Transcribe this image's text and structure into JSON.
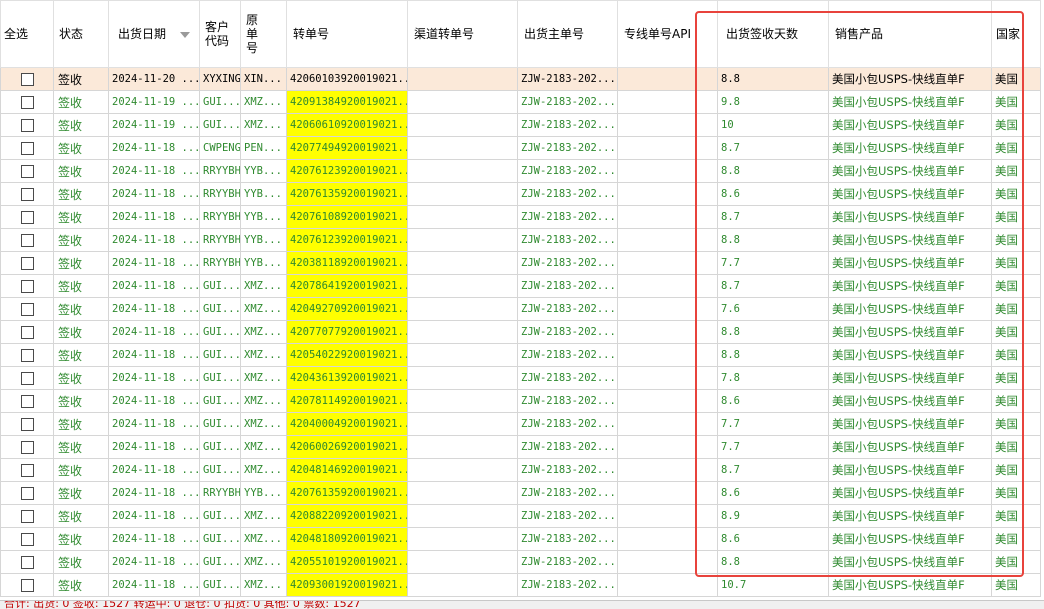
{
  "table": {
    "headers": {
      "select_all": "全选",
      "status": "状态",
      "ship_date": "出货日期",
      "customer_code": "客户代码",
      "original_no": "原单号",
      "transfer_no": "转单号",
      "channel_transfer_no": "渠道转单号",
      "master_no": "出货主单号",
      "line_api": "专线单号API",
      "sign_days": "出货签收天数",
      "product": "销售产品",
      "country": "国家"
    },
    "rows": [
      {
        "status": "签收",
        "date": "2024-11-20 ...",
        "customer": "XYXING",
        "orig": "XIN...",
        "transfer": "42060103920019021...",
        "master": "ZJW-2183-202...",
        "days": "8.8",
        "product": "美国小包USPS-快线直单F",
        "country": "美国"
      },
      {
        "status": "签收",
        "date": "2024-11-19 ...",
        "customer": "GUI...",
        "orig": "XMZ...",
        "transfer": "42091384920019021...",
        "master": "ZJW-2183-202...",
        "days": "9.8",
        "product": "美国小包USPS-快线直单F",
        "country": "美国"
      },
      {
        "status": "签收",
        "date": "2024-11-19 ...",
        "customer": "GUI...",
        "orig": "XMZ...",
        "transfer": "42060610920019021...",
        "master": "ZJW-2183-202...",
        "days": "10",
        "product": "美国小包USPS-快线直单F",
        "country": "美国"
      },
      {
        "status": "签收",
        "date": "2024-11-18 ...",
        "customer": "CWPENG",
        "orig": "PEN...",
        "transfer": "42077494920019021...",
        "master": "ZJW-2183-202...",
        "days": "8.7",
        "product": "美国小包USPS-快线直单F",
        "country": "美国"
      },
      {
        "status": "签收",
        "date": "2024-11-18 ...",
        "customer": "RRYYBH",
        "orig": "YYB...",
        "transfer": "42076123920019021...",
        "master": "ZJW-2183-202...",
        "days": "8.8",
        "product": "美国小包USPS-快线直单F",
        "country": "美国"
      },
      {
        "status": "签收",
        "date": "2024-11-18 ...",
        "customer": "RRYYBH",
        "orig": "YYB...",
        "transfer": "42076135920019021...",
        "master": "ZJW-2183-202...",
        "days": "8.6",
        "product": "美国小包USPS-快线直单F",
        "country": "美国"
      },
      {
        "status": "签收",
        "date": "2024-11-18 ...",
        "customer": "RRYYBH",
        "orig": "YYB...",
        "transfer": "42076108920019021...",
        "master": "ZJW-2183-202...",
        "days": "8.7",
        "product": "美国小包USPS-快线直单F",
        "country": "美国"
      },
      {
        "status": "签收",
        "date": "2024-11-18 ...",
        "customer": "RRYYBH",
        "orig": "YYB...",
        "transfer": "42076123920019021...",
        "master": "ZJW-2183-202...",
        "days": "8.8",
        "product": "美国小包USPS-快线直单F",
        "country": "美国"
      },
      {
        "status": "签收",
        "date": "2024-11-18 ...",
        "customer": "RRYYBH",
        "orig": "YYB...",
        "transfer": "42038118920019021...",
        "master": "ZJW-2183-202...",
        "days": "7.7",
        "product": "美国小包USPS-快线直单F",
        "country": "美国"
      },
      {
        "status": "签收",
        "date": "2024-11-18 ...",
        "customer": "GUI...",
        "orig": "XMZ...",
        "transfer": "42078641920019021...",
        "master": "ZJW-2183-202...",
        "days": "8.7",
        "product": "美国小包USPS-快线直单F",
        "country": "美国"
      },
      {
        "status": "签收",
        "date": "2024-11-18 ...",
        "customer": "GUI...",
        "orig": "XMZ...",
        "transfer": "42049270920019021...",
        "master": "ZJW-2183-202...",
        "days": "7.6",
        "product": "美国小包USPS-快线直单F",
        "country": "美国"
      },
      {
        "status": "签收",
        "date": "2024-11-18 ...",
        "customer": "GUI...",
        "orig": "XMZ...",
        "transfer": "42077077920019021...",
        "master": "ZJW-2183-202...",
        "days": "8.8",
        "product": "美国小包USPS-快线直单F",
        "country": "美国"
      },
      {
        "status": "签收",
        "date": "2024-11-18 ...",
        "customer": "GUI...",
        "orig": "XMZ...",
        "transfer": "42054022920019021...",
        "master": "ZJW-2183-202...",
        "days": "8.8",
        "product": "美国小包USPS-快线直单F",
        "country": "美国"
      },
      {
        "status": "签收",
        "date": "2024-11-18 ...",
        "customer": "GUI...",
        "orig": "XMZ...",
        "transfer": "42043613920019021...",
        "master": "ZJW-2183-202...",
        "days": "7.8",
        "product": "美国小包USPS-快线直单F",
        "country": "美国"
      },
      {
        "status": "签收",
        "date": "2024-11-18 ...",
        "customer": "GUI...",
        "orig": "XMZ...",
        "transfer": "42078114920019021...",
        "master": "ZJW-2183-202...",
        "days": "8.6",
        "product": "美国小包USPS-快线直单F",
        "country": "美国"
      },
      {
        "status": "签收",
        "date": "2024-11-18 ...",
        "customer": "GUI...",
        "orig": "XMZ...",
        "transfer": "42040004920019021...",
        "master": "ZJW-2183-202...",
        "days": "7.7",
        "product": "美国小包USPS-快线直单F",
        "country": "美国"
      },
      {
        "status": "签收",
        "date": "2024-11-18 ...",
        "customer": "GUI...",
        "orig": "XMZ...",
        "transfer": "42060026920019021...",
        "master": "ZJW-2183-202...",
        "days": "7.7",
        "product": "美国小包USPS-快线直单F",
        "country": "美国"
      },
      {
        "status": "签收",
        "date": "2024-11-18 ...",
        "customer": "GUI...",
        "orig": "XMZ...",
        "transfer": "42048146920019021...",
        "master": "ZJW-2183-202...",
        "days": "8.7",
        "product": "美国小包USPS-快线直单F",
        "country": "美国"
      },
      {
        "status": "签收",
        "date": "2024-11-18 ...",
        "customer": "RRYYBH",
        "orig": "YYB...",
        "transfer": "42076135920019021...",
        "master": "ZJW-2183-202...",
        "days": "8.6",
        "product": "美国小包USPS-快线直单F",
        "country": "美国"
      },
      {
        "status": "签收",
        "date": "2024-11-18 ...",
        "customer": "GUI...",
        "orig": "XMZ...",
        "transfer": "42088220920019021...",
        "master": "ZJW-2183-202...",
        "days": "8.9",
        "product": "美国小包USPS-快线直单F",
        "country": "美国"
      },
      {
        "status": "签收",
        "date": "2024-11-18 ...",
        "customer": "GUI...",
        "orig": "XMZ...",
        "transfer": "42048180920019021...",
        "master": "ZJW-2183-202...",
        "days": "8.6",
        "product": "美国小包USPS-快线直单F",
        "country": "美国"
      },
      {
        "status": "签收",
        "date": "2024-11-18 ...",
        "customer": "GUI...",
        "orig": "XMZ...",
        "transfer": "42055101920019021...",
        "master": "ZJW-2183-202...",
        "days": "8.8",
        "product": "美国小包USPS-快线直单F",
        "country": "美国"
      },
      {
        "status": "签收",
        "date": "2024-11-18 ...",
        "customer": "GUI...",
        "orig": "XMZ...",
        "transfer": "42093001920019021...",
        "master": "ZJW-2183-202...",
        "days": "10.7",
        "product": "美国小包USPS-快线直单F",
        "country": "美国"
      }
    ]
  },
  "footer": {
    "summary": "合计: 出货: 0 签收: 1527 转运中: 0 退仓: 0 扣货: 0 其他: 0 票数: 1527"
  },
  "colors": {
    "highlight_box": "#e8433c",
    "transfer_highlight": "#ffff00",
    "selected_row": "#fbe9d9",
    "text_green": "#2f8a2f"
  }
}
